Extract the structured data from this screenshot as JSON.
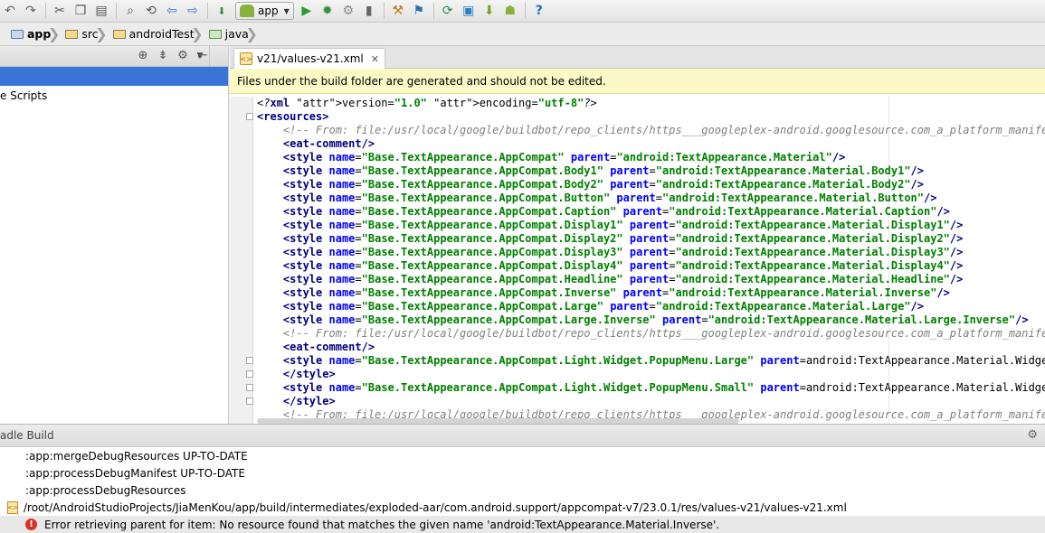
{
  "toolbar": {
    "run_config_label": "app",
    "icons": [
      "undo-icon",
      "redo-icon",
      "cut-icon",
      "copy-icon",
      "paste-icon",
      "find-icon",
      "replace-icon",
      "back-icon",
      "forward-icon",
      "make-project-icon",
      "run-icon",
      "debug-icon",
      "attach-debugger-icon",
      "monitor-icon",
      "project-structure-icon",
      "sdk-manager-icon",
      "sync-project-icon",
      "device-monitor-icon",
      "avd-manager-icon",
      "android-icon",
      "help-icon"
    ]
  },
  "breadcrumb": {
    "items": [
      {
        "label": "app",
        "icon": "module-icon",
        "bold": true
      },
      {
        "label": "src",
        "icon": "folder-icon",
        "bold": false
      },
      {
        "label": "androidTest",
        "icon": "folder-icon",
        "bold": false
      },
      {
        "label": "java",
        "icon": "source-folder-icon",
        "bold": false
      }
    ]
  },
  "project_panel": {
    "selected_item": "",
    "item_label": "e Scripts"
  },
  "editor": {
    "tab_label": "v21/values-v21.xml",
    "tab_close": "✕",
    "banner_text": "Files under the build folder are generated and should not be edited.",
    "lines": [
      "<?xml version=\"1.0\" encoding=\"utf-8\"?>",
      "<resources>",
      "    <!-- From: file:/usr/local/google/buildbot/repo_clients/https___googleplex-android.googlesource.com_a_platform_manifest.g",
      "    <eat-comment/>",
      "    <style name=\"Base.TextAppearance.AppCompat\" parent=\"android:TextAppearance.Material\"/>",
      "    <style name=\"Base.TextAppearance.AppCompat.Body1\" parent=\"android:TextAppearance.Material.Body1\"/>",
      "    <style name=\"Base.TextAppearance.AppCompat.Body2\" parent=\"android:TextAppearance.Material.Body2\"/>",
      "    <style name=\"Base.TextAppearance.AppCompat.Button\" parent=\"android:TextAppearance.Material.Button\"/>",
      "    <style name=\"Base.TextAppearance.AppCompat.Caption\" parent=\"android:TextAppearance.Material.Caption\"/>",
      "    <style name=\"Base.TextAppearance.AppCompat.Display1\" parent=\"android:TextAppearance.Material.Display1\"/>",
      "    <style name=\"Base.TextAppearance.AppCompat.Display2\" parent=\"android:TextAppearance.Material.Display2\"/>",
      "    <style name=\"Base.TextAppearance.AppCompat.Display3\" parent=\"android:TextAppearance.Material.Display3\"/>",
      "    <style name=\"Base.TextAppearance.AppCompat.Display4\" parent=\"android:TextAppearance.Material.Display4\"/>",
      "    <style name=\"Base.TextAppearance.AppCompat.Headline\" parent=\"android:TextAppearance.Material.Headline\"/>",
      "    <style name=\"Base.TextAppearance.AppCompat.Inverse\" parent=\"android:TextAppearance.Material.Inverse\"/>",
      "    <style name=\"Base.TextAppearance.AppCompat.Large\" parent=\"android:TextAppearance.Material.Large\"/>",
      "    <style name=\"Base.TextAppearance.AppCompat.Large.Inverse\" parent=\"android:TextAppearance.Material.Large.Inverse\"/>",
      "    <!-- From: file:/usr/local/google/buildbot/repo_clients/https___googleplex-android.googlesource.com_a_platform_manifest.g",
      "    <eat-comment/>",
      "    <style name=\"Base.TextAppearance.AppCompat.Light.Widget.PopupMenu.Large\" parent=\"android:TextAppearance.Material.Widget.P",
      "    </style>",
      "    <style name=\"Base.TextAppearance.AppCompat.Light.Widget.PopupMenu.Small\" parent=\"android:TextAppearance.Material.Widget.P",
      "    </style>",
      "    <!-- From: file:/usr/local/google/buildbot/repo_clients/https___googleplex-android.googlesource.com_a_platform_manifest.g"
    ]
  },
  "build_panel": {
    "title": "adle Build",
    "lines": [
      ":app:mergeDebugResources UP-TO-DATE",
      ":app:processDebugManifest UP-TO-DATE",
      ":app:processDebugResources"
    ],
    "file_path": "/root/AndroidStudioProjects/JiaMenKou/app/build/intermediates/exploded-aar/com.android.support/appcompat-v7/23.0.1/res/values-v21/values-v21.xml",
    "error_text": "Error retrieving parent for item: No resource found that matches the given name 'android:TextAppearance.Material.Inverse'."
  },
  "colors": {
    "selection": "#3875d7",
    "banner_bg": "#fbf9c6",
    "xml_tag": "#000080",
    "xml_attr": "#0000ff",
    "xml_string": "#008000",
    "comment": "#808080",
    "error": "#d9302c"
  }
}
